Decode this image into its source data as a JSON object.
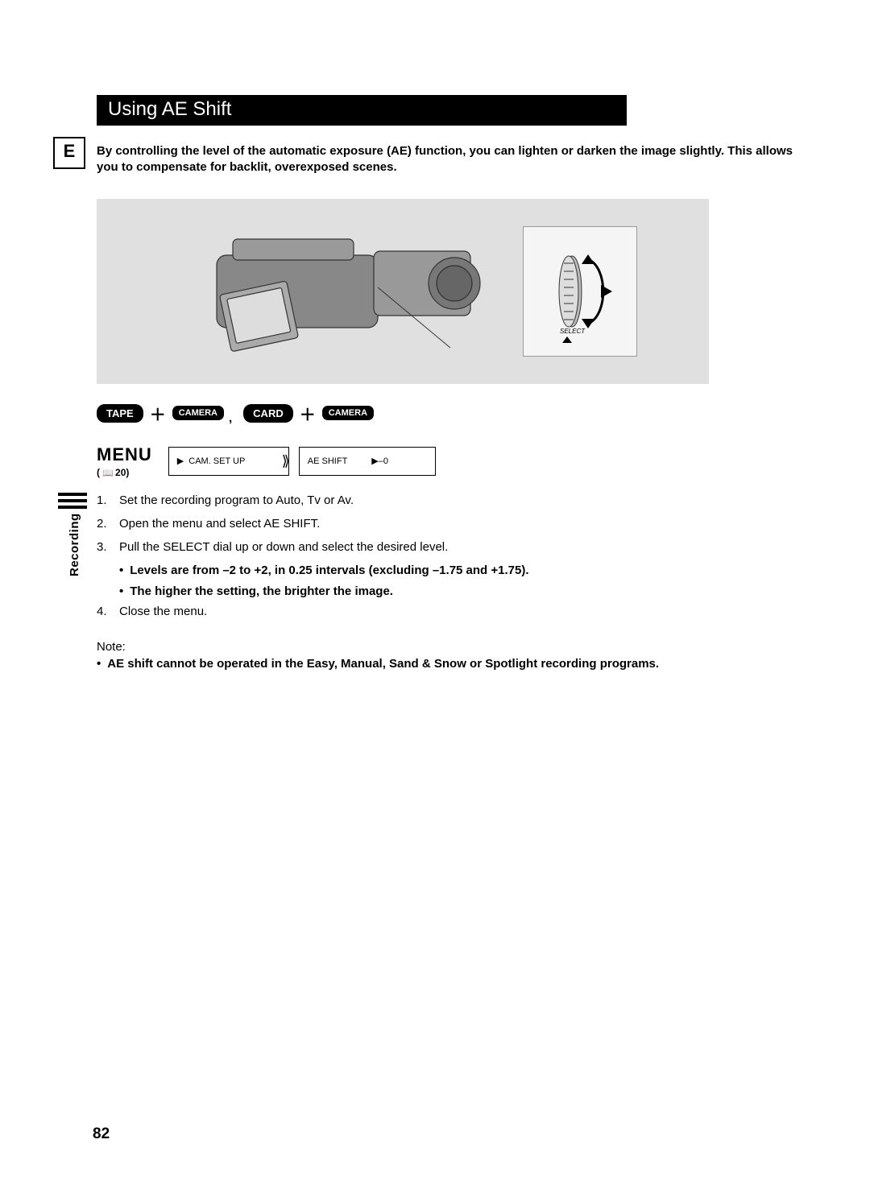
{
  "language_badge": "E",
  "side_label": "Recording",
  "title": "Using AE Shift",
  "intro_text": "By controlling the level of the automatic exposure (AE) function, you can lighten or darken the image slightly. This allows you to compensate for backlit, overexposed scenes.",
  "figure_dial_label": "SELECT",
  "mode_row": {
    "tape": "TAPE",
    "camera1": "CAMERA",
    "sep": ",",
    "card": "CARD",
    "camera2": "CAMERA"
  },
  "menu": {
    "label": "MENU",
    "ref": "20",
    "box1_text": "CAM. SET UP",
    "box2_text": "AE SHIFT",
    "box2_value": "–0"
  },
  "steps": [
    "Set the recording program to Auto, Tv or Av.",
    "Open the menu and select AE SHIFT.",
    "Pull the SELECT dial up or down and select the desired level.",
    "Close the menu."
  ],
  "step3_bullets": [
    "Levels are from –2 to +2, in 0.25 intervals (excluding –1.75 and +1.75).",
    "The higher the setting, the brighter the image."
  ],
  "note_label": "Note:",
  "note_bullet": "AE shift cannot be operated in the Easy, Manual, Sand & Snow or Spotlight recording programs.",
  "page_number": "82"
}
